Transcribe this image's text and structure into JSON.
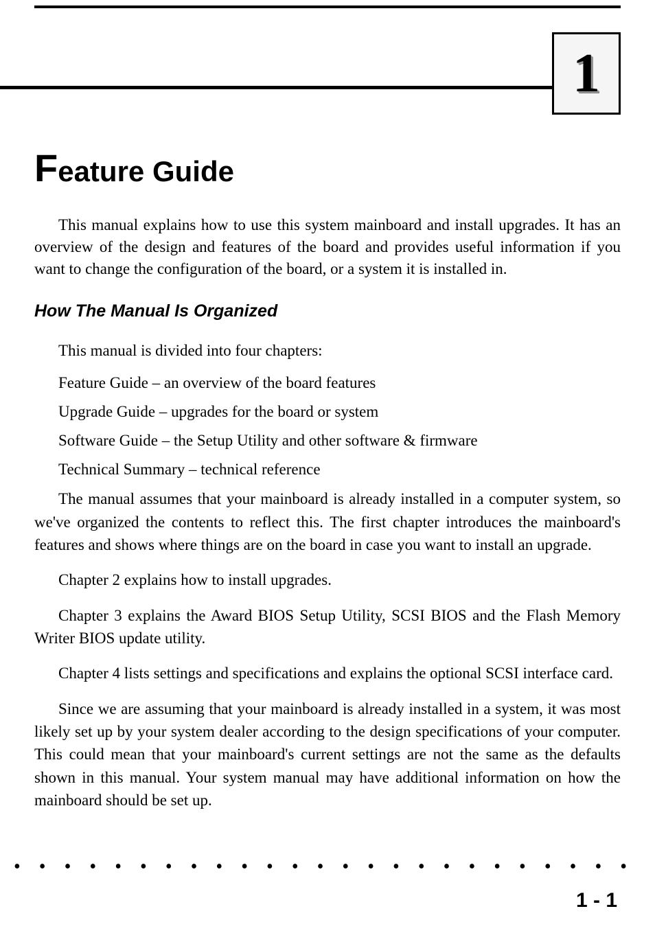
{
  "chapter_number": "1",
  "title": {
    "first_letter": "F",
    "rest": "eature Guide"
  },
  "intro": "This manual explains how to use this system mainboard and install upgrades. It has an overview of the design and features of the board and provides useful information if you want to change the configuration of the board, or a system it is installed in.",
  "subheading": "How The Manual Is Organized",
  "list_intro": "This manual is divided into four chapters:",
  "chapters": [
    "Feature Guide – an overview of the board features",
    "Upgrade Guide – upgrades for the board or system",
    "Software Guide – the Setup Utility and other software & firmware",
    "Technical Summary – technical reference"
  ],
  "paragraphs": [
    "The manual assumes that your mainboard is already installed in a computer system, so we've organized the contents to reflect this. The first chapter introduces the mainboard's features and shows where things are on the board in case you want to install an upgrade.",
    "Chapter 2 explains how to install upgrades.",
    "Chapter 3 explains the Award BIOS Setup Utility, SCSI BIOS and the Flash Memory Writer BIOS update utility.",
    "Chapter 4 lists settings and specifications and explains the optional SCSI interface card.",
    "Since we are assuming that your mainboard is already installed in a system, it was most likely set up by your system dealer according to the design specifications of your computer. This could mean that your mainboard's current settings are not the same as the defaults shown in this manual. Your system manual may have additional information on how the mainboard should be set up."
  ],
  "dots": "• • • • • • • • • • • • • • • • • • • • • • • • • • • • • • • • • • • • • • • • • • • •",
  "page_number": "1 - 1"
}
